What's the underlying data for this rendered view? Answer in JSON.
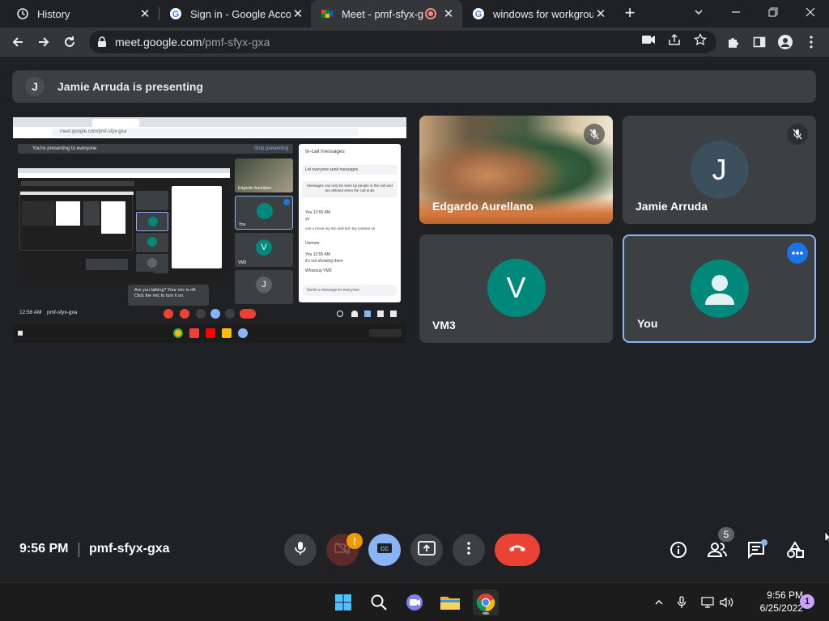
{
  "browser": {
    "tabs": [
      {
        "title": "History",
        "icon": "history-icon"
      },
      {
        "title": "Sign in - Google Accou",
        "icon": "google-icon"
      },
      {
        "title": "Meet - pmf-sfyx-g",
        "icon": "meet-icon"
      },
      {
        "title": "windows for workgrou",
        "icon": "google-icon"
      }
    ],
    "url_host": "meet.google.com",
    "url_path": "/pmf-sfyx-gxa"
  },
  "meet": {
    "banner_initial": "J",
    "banner_text": "Jamie Arruda is presenting",
    "participants": [
      {
        "name": "Edgardo Aurellano",
        "kind": "video",
        "muted": true
      },
      {
        "name": "Jamie Arruda",
        "kind": "avatar",
        "initial": "J",
        "color": "#3c4f5c",
        "muted": true
      },
      {
        "name": "VM3",
        "kind": "avatar",
        "initial": "V",
        "color": "#00897b",
        "muted": false
      },
      {
        "name": "You",
        "kind": "avatar-person",
        "color": "#00897b",
        "muted": false
      }
    ],
    "shared_screen": {
      "url": "meet.google.com/pmf-sfyx-gxa",
      "presenting_text": "You're presenting to everyone",
      "stop_text": "Stop presenting",
      "chat_title": "In-call messages",
      "chat_toggle": "Let everyone send messages",
      "chat_notice": "Messages can only be seen by people in the call and are deleted when the call ends",
      "msg1_sender": "You  12:55 AM",
      "msg1_text": "yo",
      "msg2_text": "can u move my mic and turn my camera on",
      "msg3_text": "Unmute",
      "msg4_sender": "You  12:55 AM",
      "msg4_text": "it's not showing there",
      "msg5_text": "Whassup VM3",
      "chat_placeholder": "Send a message to everyone",
      "footer_time": "12:56 AM",
      "footer_code": "pmf-sfyx-gxa",
      "tooltip": "Are you talking? Your mic is off. Click the mic to turn it on.",
      "tile_labels": [
        "Edgardo Aurellano",
        "VM3",
        "You"
      ]
    }
  },
  "controls": {
    "time": "9:56 PM",
    "meeting_code": "pmf-sfyx-gxa",
    "warning_badge": "!",
    "people_count": "5"
  },
  "taskbar": {
    "time": "9:56 PM",
    "date": "6/25/2022",
    "notifications": "1"
  }
}
